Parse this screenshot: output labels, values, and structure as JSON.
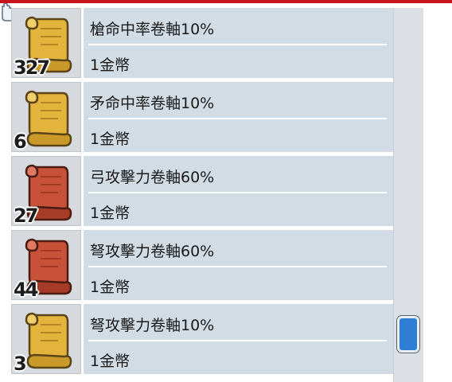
{
  "items": [
    {
      "name": "槍命中率卷軸10%",
      "price": "1金幣",
      "quantity": "327",
      "scroll_icon": "yellow-scroll-icon",
      "color": "#e2b43c"
    },
    {
      "name": "矛命中率卷軸10%",
      "price": "1金幣",
      "quantity": "6",
      "scroll_icon": "yellow-scroll-icon",
      "color": "#e2b43c"
    },
    {
      "name": "弓攻擊力卷軸60%",
      "price": "1金幣",
      "quantity": "27",
      "scroll_icon": "red-scroll-icon",
      "color": "#c8513a"
    },
    {
      "name": "弩攻擊力卷軸60%",
      "price": "1金幣",
      "quantity": "44",
      "scroll_icon": "red-scroll-icon",
      "color": "#c8513a"
    },
    {
      "name": "弩攻擊力卷軸10%",
      "price": "1金幣",
      "quantity": "3",
      "scroll_icon": "yellow-scroll-icon",
      "color": "#e2b43c"
    }
  ],
  "colors": {
    "accent_bar": "#c8141c",
    "row_background": "#d1dce5",
    "scroll_thumb": "#2e7fd3"
  }
}
